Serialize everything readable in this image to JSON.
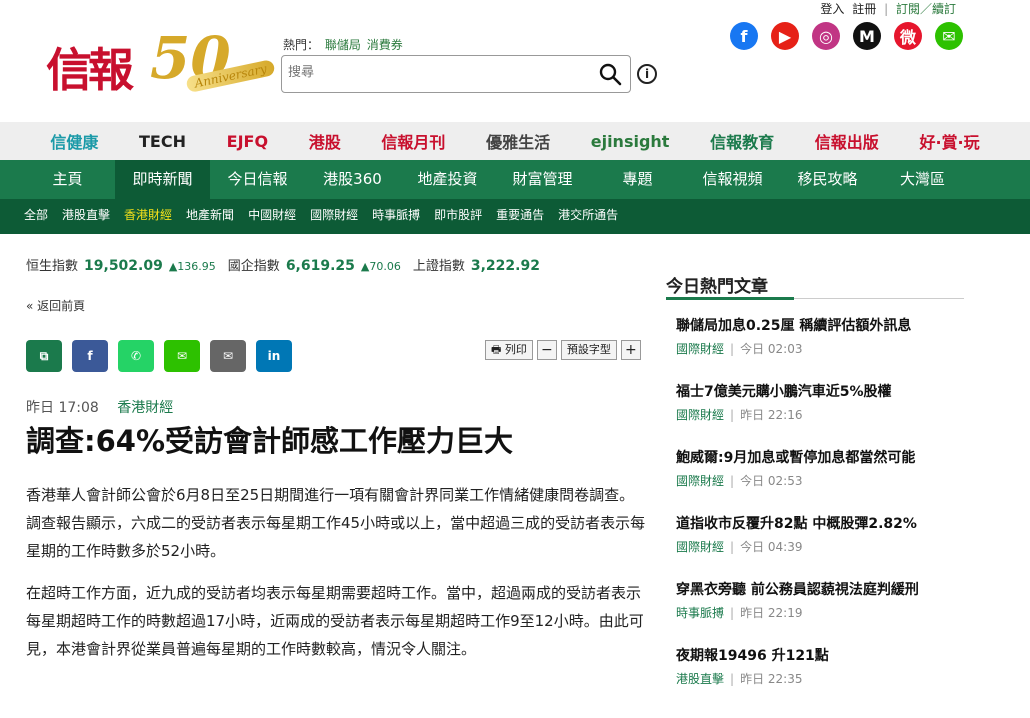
{
  "header": {
    "hot_label": "熱門：",
    "hot_links": [
      "聯儲局",
      "消費券"
    ],
    "search_placeholder": "搜尋",
    "top_links": {
      "login": "登入",
      "register": "註冊",
      "subscribe": "訂閱／續訂"
    },
    "logo": {
      "cn": "信報",
      "fifty": "50",
      "anniversary": "Anniversary"
    }
  },
  "social": [
    {
      "name": "facebook-icon",
      "glyph": "f",
      "color": "#1877f2"
    },
    {
      "name": "youtube-icon",
      "glyph": "▶",
      "color": "#e62117"
    },
    {
      "name": "instagram-icon",
      "glyph": "◎",
      "color": "#c13584"
    },
    {
      "name": "medium-icon",
      "glyph": "M",
      "color": "#111111"
    },
    {
      "name": "weibo-icon",
      "glyph": "微",
      "color": "#e6162d"
    },
    {
      "name": "wechat-icon",
      "glyph": "✉",
      "color": "#2dc100"
    }
  ],
  "brands": [
    {
      "label": "信健康",
      "color": "#1b9aa8"
    },
    {
      "label": "TECH",
      "color": "#222222"
    },
    {
      "label": "EJFQ",
      "color": "#c8102e"
    },
    {
      "label": "港股",
      "color": "#c8102e"
    },
    {
      "label": "信報月刊",
      "color": "#c8102e"
    },
    {
      "label": "優雅生活",
      "color": "#444444"
    },
    {
      "label": "ejinsight",
      "color": "#2b7a3d"
    },
    {
      "label": "信報教育",
      "color": "#1b7a4c"
    },
    {
      "label": "信報出版",
      "color": "#c8102e"
    },
    {
      "label": "好·賞·玩",
      "color": "#c8102e"
    }
  ],
  "main_nav": [
    "主頁",
    "即時新聞",
    "今日信報",
    "港股360",
    "地產投資",
    "財富管理",
    "專題",
    "信報視頻",
    "移民攻略",
    "大灣區"
  ],
  "main_nav_active": 1,
  "sub_nav": [
    "全部",
    "港股直擊",
    "香港財經",
    "地產新聞",
    "中國財經",
    "國際財經",
    "時事脈搏",
    "即市股評",
    "重要通告",
    "港交所通告"
  ],
  "sub_nav_active": 2,
  "ticker": [
    {
      "label": "恒生指數",
      "value": "19,502.09",
      "change": "▲136.95"
    },
    {
      "label": "國企指數",
      "value": "6,619.25",
      "change": "▲70.06"
    },
    {
      "label": "上證指數",
      "value": "3,222.92",
      "change": ""
    }
  ],
  "back_link": "« 返回前頁",
  "share": [
    {
      "name": "copy-link-icon",
      "glyph": "⧉",
      "color": "#1b7a4c"
    },
    {
      "name": "facebook-share-icon",
      "glyph": "f",
      "color": "#3b5998"
    },
    {
      "name": "whatsapp-share-icon",
      "glyph": "✆",
      "color": "#25d366"
    },
    {
      "name": "wechat-share-icon",
      "glyph": "✉",
      "color": "#2dc100"
    },
    {
      "name": "email-share-icon",
      "glyph": "✉",
      "color": "#666666"
    },
    {
      "name": "linkedin-share-icon",
      "glyph": "in",
      "color": "#0077b5"
    }
  ],
  "tools": {
    "print": "列印",
    "minus": "−",
    "font": "預設字型",
    "plus": "+"
  },
  "article": {
    "time": "昨日 17:08",
    "category": "香港財經",
    "headline": "調查:64%受訪會計師感工作壓力巨大",
    "paragraphs": [
      "香港華人會計師公會於6月8日至25日期間進行一項有關會計界同業工作情緒健康問卷調查。調查報告顯示，六成二的受訪者表示每星期工作45小時或以上，當中超過三成的受訪者表示每星期的工作時數多於52小時。",
      "在超時工作方面，近九成的受訪者均表示每星期需要超時工作。當中，超過兩成的受訪者表示每星期超時工作的時數超過17小時，近兩成的受訪者表示每星期超時工作9至12小時。由此可見，本港會計界從業員普遍每星期的工作時數較高，情況令人關注。"
    ]
  },
  "sidebar": {
    "title": "今日熱門文章",
    "items": [
      {
        "title": "聯儲局加息0.25厘 稱續評估額外訊息",
        "category": "國際財經",
        "time": "今日 02:03"
      },
      {
        "title": "福士7億美元購小鵬汽車近5%股權",
        "category": "國際財經",
        "time": "昨日 22:16"
      },
      {
        "title": "鮑威爾:9月加息或暫停加息都當然可能",
        "category": "國際財經",
        "time": "今日 02:53"
      },
      {
        "title": "道指收市反覆升82點 中概股彈2.82%",
        "category": "國際財經",
        "time": "今日 04:39"
      },
      {
        "title": "穿黑衣旁聽 前公務員認藐視法庭判緩刑",
        "category": "時事脈搏",
        "time": "昨日 22:19"
      },
      {
        "title": "夜期報19496 升121點",
        "category": "港股直擊",
        "time": "昨日 22:35"
      }
    ]
  }
}
